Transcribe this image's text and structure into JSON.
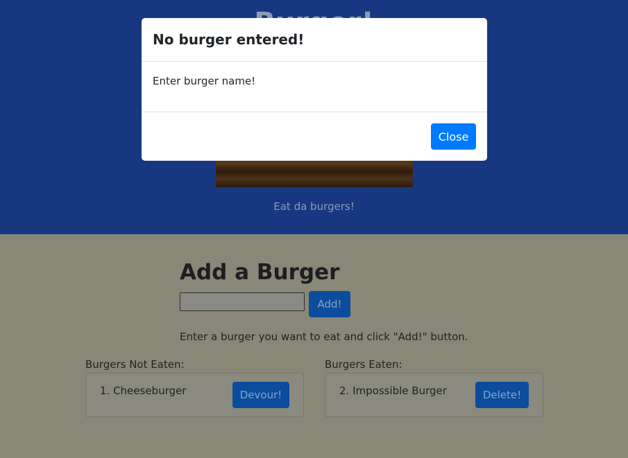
{
  "header": {
    "title": "Burger!",
    "tagline": "Eat da burgers!"
  },
  "add_section": {
    "heading": "Add a Burger",
    "input_value": "",
    "add_button": "Add!",
    "hint": "Enter a burger you want to eat and click \"Add!\" button."
  },
  "not_eaten": {
    "label": "Burgers Not Eaten:",
    "items": [
      {
        "text": "1. Cheeseburger",
        "button": "Devour!"
      }
    ]
  },
  "eaten": {
    "label": "Burgers Eaten:",
    "items": [
      {
        "text": "2. Impossible Burger",
        "button": "Delete!"
      }
    ]
  },
  "modal": {
    "title": "No burger entered!",
    "body": "Enter burger name!",
    "close_button": "Close"
  },
  "colors": {
    "header_bg": "#173781",
    "primary": "#007bff"
  }
}
